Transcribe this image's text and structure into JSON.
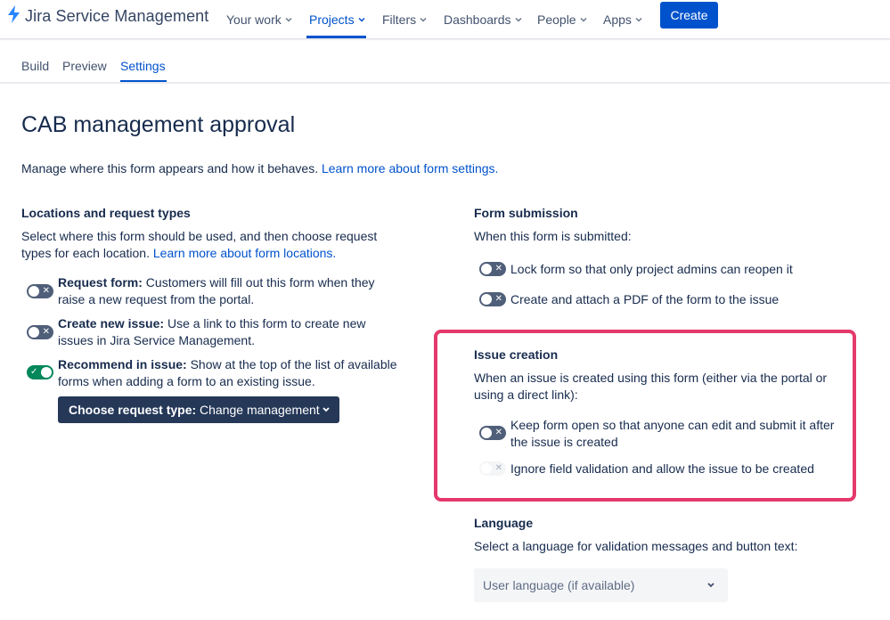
{
  "nav": {
    "app_name": "Jira Service Management",
    "items": [
      {
        "label": "Your work"
      },
      {
        "label": "Projects"
      },
      {
        "label": "Filters"
      },
      {
        "label": "Dashboards"
      },
      {
        "label": "People"
      },
      {
        "label": "Apps"
      }
    ],
    "active_item": "Projects",
    "create_label": "Create"
  },
  "tabs": [
    {
      "label": "Build"
    },
    {
      "label": "Preview"
    },
    {
      "label": "Settings"
    }
  ],
  "active_tab": "Settings",
  "page": {
    "title": "CAB management approval",
    "intro_text": "Manage where this form appears and how it behaves. ",
    "intro_link": "Learn more about form settings."
  },
  "locations": {
    "heading": "Locations and request types",
    "description_line1": "Select where this form should be used, and then choose request",
    "description_line2": "types for each location. ",
    "description_link": "Learn more about form locations.",
    "options": [
      {
        "title": "Request form:",
        "text_line1": " Customers will fill out this form when they",
        "text_line2": "raise a new request from the portal.",
        "enabled": false
      },
      {
        "title": "Create new issue:",
        "text_line1": " Use a link to this form to create new",
        "text_line2": "issues in Jira Service Management.",
        "enabled": false
      },
      {
        "title": "Recommend in issue:",
        "text_line1": " Show at the top of the list of available",
        "text_line2": "forms when adding a form to an existing issue.",
        "enabled": true
      }
    ],
    "request_type_button": {
      "label": "Choose request type:",
      "value": " Change management"
    }
  },
  "form_submission": {
    "heading": "Form submission",
    "description": "When this form is submitted:",
    "options": [
      {
        "text": "Lock form so that only project admins can reopen it",
        "enabled": false
      },
      {
        "text": "Create and attach a PDF of the form to the issue",
        "enabled": false
      }
    ]
  },
  "issue_creation": {
    "heading": "Issue creation",
    "description_line1": "When an issue is created using this form (either via the portal or",
    "description_line2": "using a direct link):",
    "options": [
      {
        "text_line1": "Keep form open so that anyone can edit and submit it after",
        "text_line2": "the issue is created",
        "enabled": false
      },
      {
        "text": "Ignore field validation and allow the issue to be created",
        "enabled": false,
        "disabled": true
      }
    ],
    "highlight_color": "#e5396b"
  },
  "language": {
    "heading": "Language",
    "description": "Select a language for validation messages and button text:",
    "selected": "User language (if available)"
  },
  "colors": {
    "brand": "#0052cc",
    "toggle_off": "#505f79",
    "toggle_on": "#00875a",
    "button_dark": "#253858"
  }
}
